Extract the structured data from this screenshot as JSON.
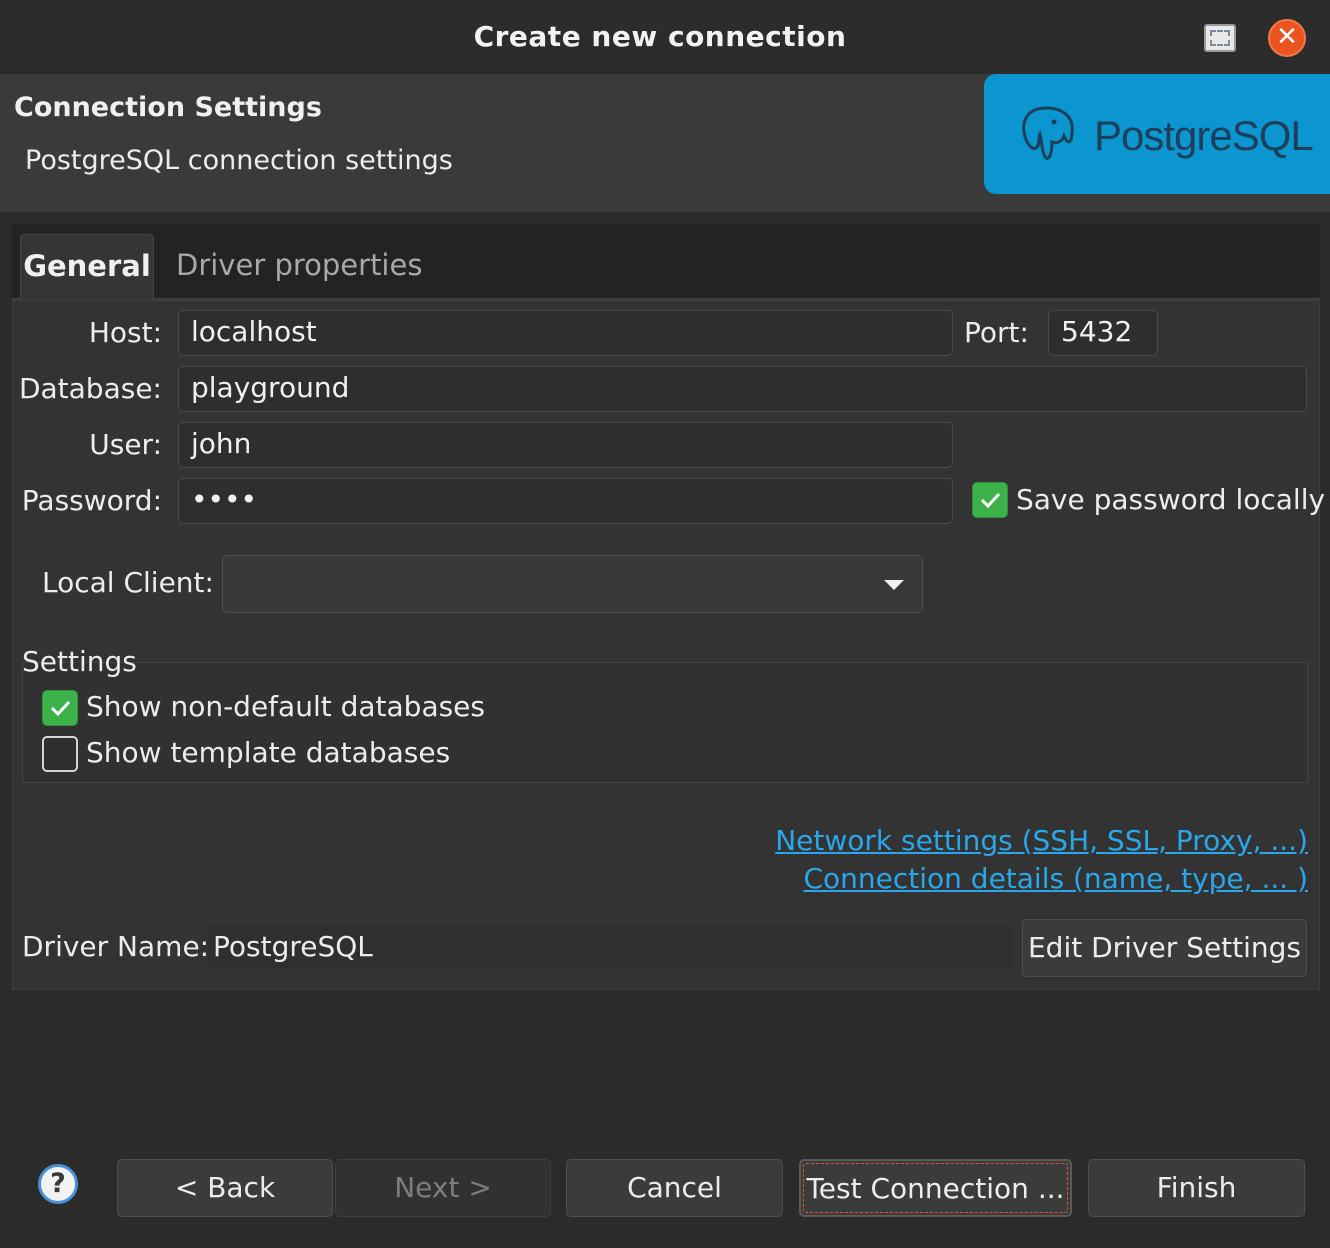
{
  "window": {
    "title": "Create new connection"
  },
  "header": {
    "title": "Connection Settings",
    "subtitle": "PostgreSQL connection settings",
    "logo_text": "PostgreSQL"
  },
  "tabs": [
    {
      "label": "General",
      "active": true
    },
    {
      "label": "Driver properties",
      "active": false
    }
  ],
  "form": {
    "host_label": "Host:",
    "host_value": "localhost",
    "port_label": "Port:",
    "port_value": "5432",
    "database_label": "Database:",
    "database_value": "playground",
    "user_label": "User:",
    "user_value": "john",
    "password_label": "Password:",
    "password_value": "••••",
    "save_password_label": "Save password locally",
    "save_password_checked": true,
    "local_client_label": "Local Client:",
    "local_client_value": ""
  },
  "settings": {
    "legend": "Settings",
    "show_non_default_label": "Show non-default databases",
    "show_non_default_checked": true,
    "show_template_label": "Show template databases",
    "show_template_checked": false
  },
  "links": {
    "network": "Network settings (SSH, SSL, Proxy, ...)",
    "details": "Connection details (name, type, ... )"
  },
  "driver": {
    "name_label": "Driver Name:",
    "name_value": "PostgreSQL",
    "edit_button": "Edit Driver Settings"
  },
  "buttons": {
    "help": "?",
    "back": "< Back",
    "next": "Next >",
    "cancel": "Cancel",
    "test": "Test Connection ...",
    "finish": "Finish"
  },
  "colors": {
    "accent": "#e95420",
    "check": "#3db24a",
    "link": "#2aa7ea",
    "banner": "#0b96cf"
  }
}
